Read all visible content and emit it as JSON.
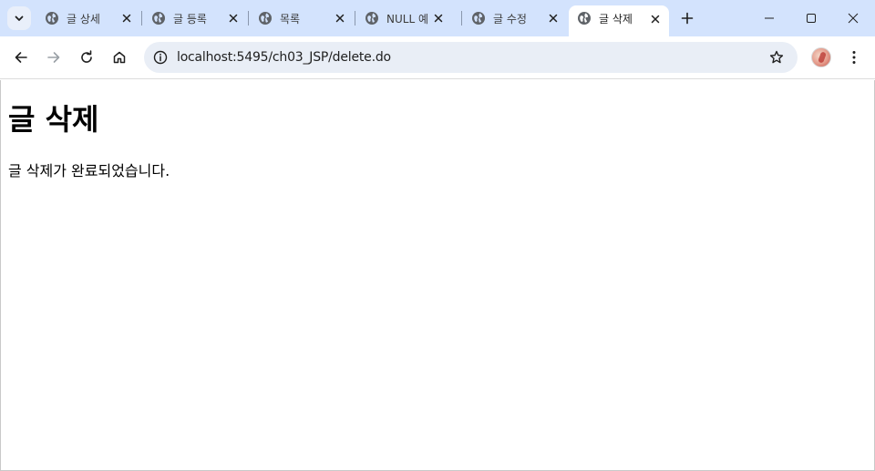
{
  "browser": {
    "tabs": [
      {
        "label": "글 상세",
        "active": false
      },
      {
        "label": "글 등록",
        "active": false
      },
      {
        "label": "목록",
        "active": false
      },
      {
        "label": "NULL 예",
        "active": false
      },
      {
        "label": "글 수정",
        "active": false
      },
      {
        "label": "글 삭제",
        "active": true
      }
    ],
    "address": {
      "url": "localhost:5495/ch03_JSP/delete.do"
    },
    "icons": {
      "tab_search": "chevron-down-icon",
      "tab_favicon": "globe-icon",
      "tab_close": "close-icon",
      "new_tab": "plus-icon",
      "minimize": "minimize-icon",
      "maximize": "maximize-icon",
      "window_close": "close-icon",
      "back": "arrow-left-icon",
      "forward": "arrow-right-icon",
      "reload": "reload-icon",
      "home": "home-icon",
      "site_info": "info-icon",
      "bookmark": "star-icon",
      "menu": "kebab-menu-icon"
    },
    "colors": {
      "tabbar": "#d3e3fd",
      "omnibox": "#e9eef6",
      "active_tab": "#ffffff"
    }
  },
  "page": {
    "heading": "글 삭제",
    "message": "글 삭제가 완료되었습니다."
  }
}
